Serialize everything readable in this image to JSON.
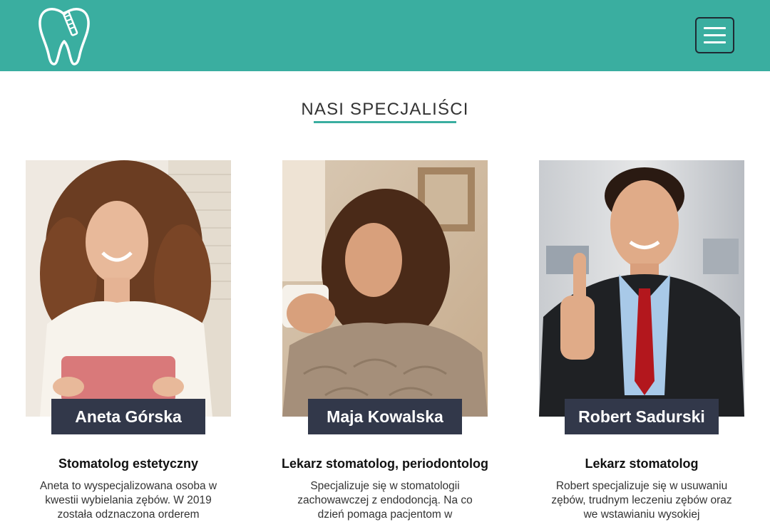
{
  "header": {
    "logo_icon": "tooth-with-toothbrush-icon",
    "menu_icon": "hamburger-menu-icon",
    "bg_color": "#3aaea0"
  },
  "section": {
    "title": "NASI SPECJALIŚCI",
    "accent_color": "#3aaea0"
  },
  "specialists": [
    {
      "name": "Aneta Górska",
      "role": "Stomatolog estetyczny",
      "description": "Aneta to wyspecjalizowana osoba w kwestii wybielania zębów. W 2019 została odznaczona orderem"
    },
    {
      "name": "Maja Kowalska",
      "role": "Lekarz stomatolog, periodontolog",
      "description": "Specjalizuje się w stomatologii zachowawczej z endodoncją. Na co dzień pomaga pacjentom w"
    },
    {
      "name": "Robert Sadurski",
      "role": "Lekarz stomatolog",
      "description": "Robert specjalizuje się w usuwaniu zębów, trudnym leczeniu zębów oraz we wstawianiu wysokiej"
    }
  ]
}
